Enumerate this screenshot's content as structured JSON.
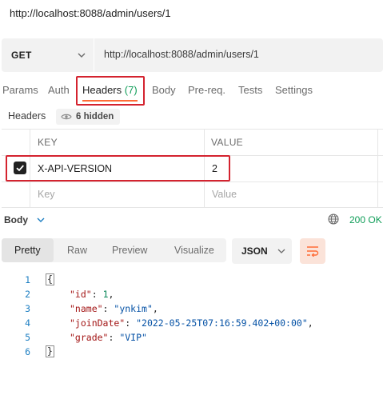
{
  "request": {
    "title": "http://localhost:8088/admin/users/1",
    "method": "GET",
    "url": "http://localhost:8088/admin/users/1"
  },
  "tabs": {
    "params": "Params",
    "auth": "Auth",
    "headers_label": "Headers",
    "headers_count": "(7)",
    "body": "Body",
    "prereq": "Pre-req.",
    "tests": "Tests",
    "settings": "Settings"
  },
  "headers_section": {
    "label": "Headers",
    "hidden_text": "6 hidden",
    "columns": {
      "key": "KEY",
      "value": "VALUE"
    },
    "rows": [
      {
        "checked": true,
        "key": "X-API-VERSION",
        "value": "2"
      }
    ],
    "placeholder": {
      "key": "Key",
      "value": "Value"
    }
  },
  "response": {
    "body_label": "Body",
    "status": "200 OK",
    "view_tabs": [
      "Pretty",
      "Raw",
      "Preview",
      "Visualize"
    ],
    "active_view": "Pretty",
    "format": "JSON",
    "code": {
      "line_numbers": [
        "1",
        "2",
        "3",
        "4",
        "5",
        "6"
      ],
      "open_brace": "{",
      "close_brace": "}",
      "fields": [
        {
          "key": "\"id\"",
          "value": "1",
          "type": "num",
          "comma": ","
        },
        {
          "key": "\"name\"",
          "value": "\"ynkim\"",
          "type": "str",
          "comma": ","
        },
        {
          "key": "\"joinDate\"",
          "value": "\"2022-05-25T07:16:59.402+00:00\"",
          "type": "str",
          "comma": ","
        },
        {
          "key": "\"grade\"",
          "value": "\"VIP\"",
          "type": "str",
          "comma": ""
        }
      ]
    }
  },
  "colors": {
    "accent": "#ff6c37",
    "highlight_border": "#d4232f",
    "success": "#0f9d58"
  },
  "icons": [
    "chevron-down-icon",
    "eye-icon",
    "checkmark-icon",
    "globe-icon",
    "wrap-lines-icon"
  ]
}
